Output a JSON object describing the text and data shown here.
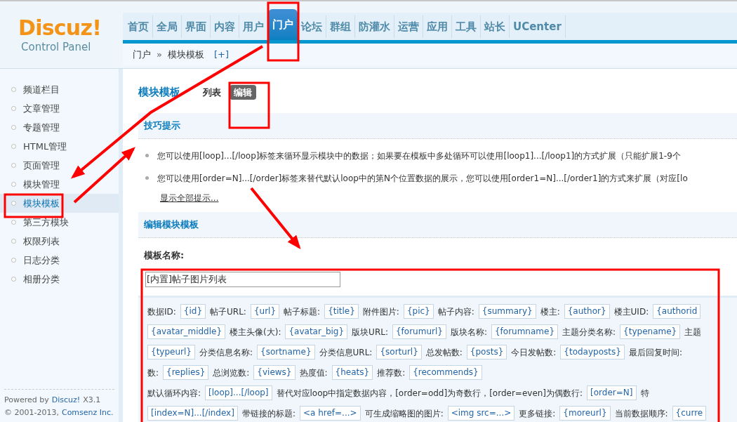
{
  "logo": {
    "title": "Discuz!",
    "subtitle": "Control Panel"
  },
  "nav": [
    {
      "label": "首页",
      "selected": false
    },
    {
      "label": "全局",
      "selected": false
    },
    {
      "label": "界面",
      "selected": false
    },
    {
      "label": "内容",
      "selected": false
    },
    {
      "label": "用户",
      "selected": false
    },
    {
      "label": "门户",
      "selected": true
    },
    {
      "label": "论坛",
      "selected": false
    },
    {
      "label": "群组",
      "selected": false
    },
    {
      "label": "防灌水",
      "selected": false
    },
    {
      "label": "运营",
      "selected": false
    },
    {
      "label": "应用",
      "selected": false
    },
    {
      "label": "工具",
      "selected": false
    },
    {
      "label": "站长",
      "selected": false
    },
    {
      "label": "UCenter",
      "selected": false
    }
  ],
  "breadcrumb": {
    "items": [
      "门户",
      "模块模板"
    ],
    "separator": "»",
    "add": "[+]"
  },
  "sidebar": {
    "items": [
      {
        "label": "频道栏目",
        "selected": false
      },
      {
        "label": "文章管理",
        "selected": false
      },
      {
        "label": "专题管理",
        "selected": false
      },
      {
        "label": "HTML管理",
        "selected": false
      },
      {
        "label": "页面管理",
        "selected": false
      },
      {
        "label": "模块管理",
        "selected": false
      },
      {
        "label": "模块模板",
        "selected": true
      },
      {
        "label": "第三方模块",
        "selected": false
      },
      {
        "label": "权限列表",
        "selected": false
      },
      {
        "label": "日志分类",
        "selected": false
      },
      {
        "label": "相册分类",
        "selected": false
      }
    ],
    "footer": {
      "powered_by": "Powered by",
      "product": "Discuz!",
      "version": "X3.1",
      "copyright": "© 2001-2013,",
      "company": "Comsenz Inc."
    }
  },
  "page": {
    "title": "模块模板",
    "tabs": [
      {
        "label": "列表",
        "selected": false
      },
      {
        "label": "编辑",
        "selected": true
      }
    ]
  },
  "tips": {
    "title": "技巧提示",
    "items": [
      "您可以使用[loop]...[/loop]标签来循环显示模块中的数据；如果要在模板中多处循环可以使用[loop1]...[/loop1]的方式扩展（只能扩展1-9个",
      "您可以使用[order=N]...[/order]标签来替代默认loop中的第N个位置数据的展示，您可以使用[order1=N]...[/order1]的方式来扩展（对应[lo"
    ],
    "show_all": "显示全部提示..."
  },
  "editor": {
    "title": "编辑模块模板",
    "name_label": "模板名称:",
    "name_value": "[内置]帖子图片列表",
    "lines": [
      [
        {
          "kind": "label",
          "text": "数据ID:"
        },
        {
          "kind": "tag",
          "text": "{id}"
        },
        {
          "kind": "label",
          "text": "帖子URL:"
        },
        {
          "kind": "tag",
          "text": "{url}"
        },
        {
          "kind": "label",
          "text": "帖子标题:"
        },
        {
          "kind": "tag",
          "text": "{title}"
        },
        {
          "kind": "label",
          "text": "附件图片:"
        },
        {
          "kind": "tag",
          "text": "{pic}"
        },
        {
          "kind": "label",
          "text": "帖子内容:"
        },
        {
          "kind": "tag",
          "text": "{summary}"
        },
        {
          "kind": "label",
          "text": "楼主:"
        },
        {
          "kind": "tag",
          "text": "{author}"
        },
        {
          "kind": "label",
          "text": "楼主UID:"
        },
        {
          "kind": "tag",
          "text": "{authorid"
        }
      ],
      [
        {
          "kind": "tag",
          "text": "{avatar_middle}"
        },
        {
          "kind": "label",
          "text": "楼主头像(大):"
        },
        {
          "kind": "tag",
          "text": "{avatar_big}"
        },
        {
          "kind": "label",
          "text": "版块URL:"
        },
        {
          "kind": "tag",
          "text": "{forumurl}"
        },
        {
          "kind": "label",
          "text": "版块名称:"
        },
        {
          "kind": "tag",
          "text": "{forumname}"
        },
        {
          "kind": "label",
          "text": "主题分类名称:"
        },
        {
          "kind": "tag",
          "text": "{typename}"
        },
        {
          "kind": "label",
          "text": "主题"
        }
      ],
      [
        {
          "kind": "tag",
          "text": "{typeurl}"
        },
        {
          "kind": "label",
          "text": "分类信息名称:"
        },
        {
          "kind": "tag",
          "text": "{sortname}"
        },
        {
          "kind": "label",
          "text": "分类信息URL:"
        },
        {
          "kind": "tag",
          "text": "{sorturl}"
        },
        {
          "kind": "label",
          "text": "总发帖数:"
        },
        {
          "kind": "tag",
          "text": "{posts}"
        },
        {
          "kind": "label",
          "text": "今日发帖数:"
        },
        {
          "kind": "tag",
          "text": "{todayposts}"
        },
        {
          "kind": "label",
          "text": "最后回复时间:"
        }
      ],
      [
        {
          "kind": "label",
          "text": "数:"
        },
        {
          "kind": "tag",
          "text": "{replies}"
        },
        {
          "kind": "label",
          "text": "总浏览数:"
        },
        {
          "kind": "tag",
          "text": "{views}"
        },
        {
          "kind": "label",
          "text": "热度值:"
        },
        {
          "kind": "tag",
          "text": "{heats}"
        },
        {
          "kind": "label",
          "text": "推荐数:"
        },
        {
          "kind": "tag",
          "text": "{recommends}"
        }
      ],
      [
        {
          "kind": "label",
          "text": "默认循环内容:"
        },
        {
          "kind": "tag",
          "text": "[loop]...[/loop]"
        },
        {
          "kind": "label",
          "text": "替代对应loop中指定数据内容，[order=odd]为奇数行，[order=even]为偶数行:"
        },
        {
          "kind": "tag",
          "text": "[order=N]"
        },
        {
          "kind": "label",
          "text": "特"
        }
      ],
      [
        {
          "kind": "tag",
          "text": "[index=N]...[/index]"
        },
        {
          "kind": "label",
          "text": "带链接的标题:"
        },
        {
          "kind": "tag",
          "text": "<a href=...>"
        },
        {
          "kind": "label",
          "text": "可生成缩略图的图片:"
        },
        {
          "kind": "tag",
          "text": "<img src=...>"
        },
        {
          "kind": "label",
          "text": "更多链接:"
        },
        {
          "kind": "tag",
          "text": "{moreurl}"
        },
        {
          "kind": "label",
          "text": "当前数据顺序:"
        },
        {
          "kind": "tag",
          "text": "{curre"
        }
      ]
    ]
  }
}
